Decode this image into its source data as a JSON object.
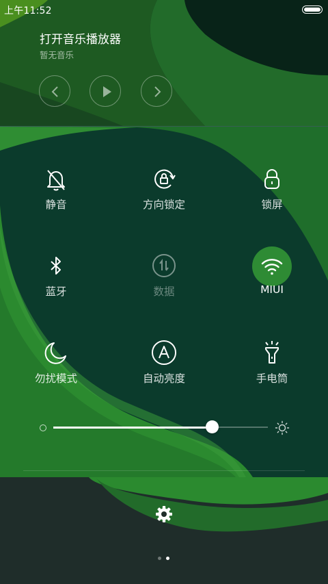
{
  "status_bar": {
    "time": "上午11:52"
  },
  "music": {
    "title": "打开音乐播放器",
    "subtitle": "暂无音乐",
    "controls": [
      "previous-icon",
      "play-icon",
      "next-icon"
    ]
  },
  "quick_toggles": [
    {
      "label": "静音",
      "icon": "bell-off-icon",
      "state": "off"
    },
    {
      "label": "方向锁定",
      "icon": "rotation-lock-icon",
      "state": "off"
    },
    {
      "label": "锁屏",
      "icon": "lock-icon",
      "state": "off"
    },
    {
      "label": "蓝牙",
      "icon": "bluetooth-icon",
      "state": "off"
    },
    {
      "label": "数据",
      "icon": "mobile-data-icon",
      "state": "disabled"
    },
    {
      "label": "MIUI",
      "icon": "wifi-icon",
      "state": "on"
    },
    {
      "label": "勿扰模式",
      "icon": "moon-icon",
      "state": "off"
    },
    {
      "label": "自动亮度",
      "icon": "auto-brightness-icon",
      "state": "off"
    },
    {
      "label": "手电筒",
      "icon": "flashlight-icon",
      "state": "off"
    }
  ],
  "brightness": {
    "level": 0.74
  },
  "pager": {
    "pages": 2,
    "current": 2
  },
  "colors": {
    "active_tile": "#2e8b34",
    "background": "#0b3b2c",
    "accent_green": "#2b8a2f"
  }
}
